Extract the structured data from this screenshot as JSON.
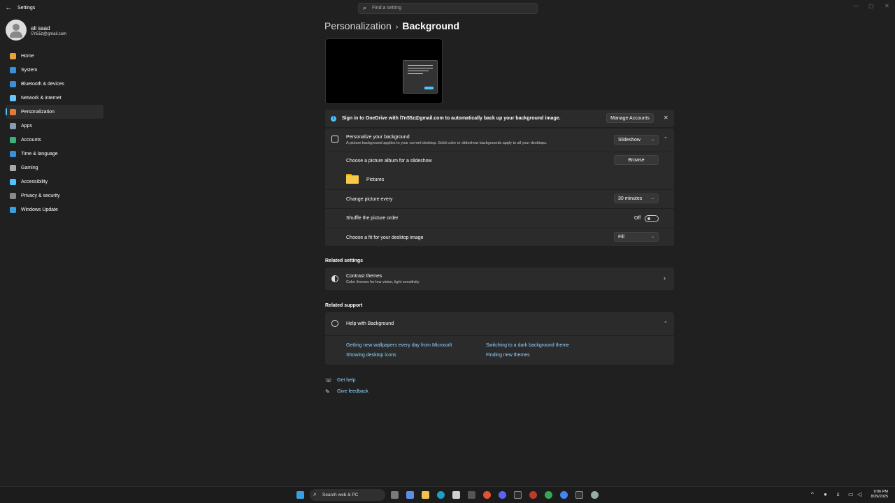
{
  "app": {
    "title": "Settings",
    "back_glyph": "←"
  },
  "search": {
    "placeholder": "Find a setting"
  },
  "user": {
    "name": "ali saad",
    "email": "l7n55z@gmail.com"
  },
  "nav": [
    {
      "label": "Home",
      "icon": "home-icon",
      "color": "#e8a33b"
    },
    {
      "label": "System",
      "icon": "system-icon",
      "color": "#3b8fd9"
    },
    {
      "label": "Bluetooth & devices",
      "icon": "bluetooth-icon",
      "color": "#3b8fd9"
    },
    {
      "label": "Network & internet",
      "icon": "wifi-icon",
      "color": "#6cc4f5"
    },
    {
      "label": "Personalization",
      "icon": "brush-icon",
      "color": "#e07b3b",
      "active": true
    },
    {
      "label": "Apps",
      "icon": "apps-icon",
      "color": "#8a9ab0"
    },
    {
      "label": "Accounts",
      "icon": "accounts-icon",
      "color": "#3bb07c"
    },
    {
      "label": "Time & language",
      "icon": "time-language-icon",
      "color": "#3b8fd9"
    },
    {
      "label": "Gaming",
      "icon": "gaming-icon",
      "color": "#aaaaaa"
    },
    {
      "label": "Accessibility",
      "icon": "accessibility-icon",
      "color": "#4cc2ff"
    },
    {
      "label": "Privacy & security",
      "icon": "shield-icon",
      "color": "#8a8a8a"
    },
    {
      "label": "Windows Update",
      "icon": "update-icon",
      "color": "#3b9ee0"
    }
  ],
  "breadcrumb": {
    "parent": "Personalization",
    "separator": "›",
    "current": "Background"
  },
  "onedrive": {
    "message": "Sign in to OneDrive with l7n55z@gmail.com to automatically back up your background image.",
    "manage_label": "Manage Accounts",
    "close_glyph": "✕"
  },
  "personalize": {
    "title": "Personalize your background",
    "description": "A picture background applies to your current desktop. Solid color or slideshow backgrounds apply to all your desktops.",
    "type_value": "Slideshow",
    "album_label": "Choose a picture album for a slideshow",
    "browse_label": "Browse",
    "folder_name": "Pictures",
    "change_label": "Change picture every",
    "change_value": "30 minutes",
    "shuffle_label": "Shuffle the picture order",
    "shuffle_state": "Off",
    "fit_label": "Choose a fit for your desktop image",
    "fit_value": "Fill"
  },
  "related_settings": {
    "heading": "Related settings",
    "contrast_title": "Contrast themes",
    "contrast_desc": "Color themes for low vision, light sensitivity"
  },
  "related_support": {
    "heading": "Related support",
    "help_title": "Help with Background",
    "links": [
      "Getting new wallpapers every day from Microsoft",
      "Switching to a dark background theme",
      "Showing desktop icons",
      "Finding new themes"
    ]
  },
  "footer": {
    "get_help": "Get help",
    "give_feedback": "Give feedback"
  },
  "taskbar": {
    "search_label": "Search web & PC",
    "time": "9:06 PM",
    "date": "8/29/2025"
  },
  "colors": {
    "accent": "#4cc2ff",
    "background": "#202020",
    "card": "#2b2b2b"
  }
}
